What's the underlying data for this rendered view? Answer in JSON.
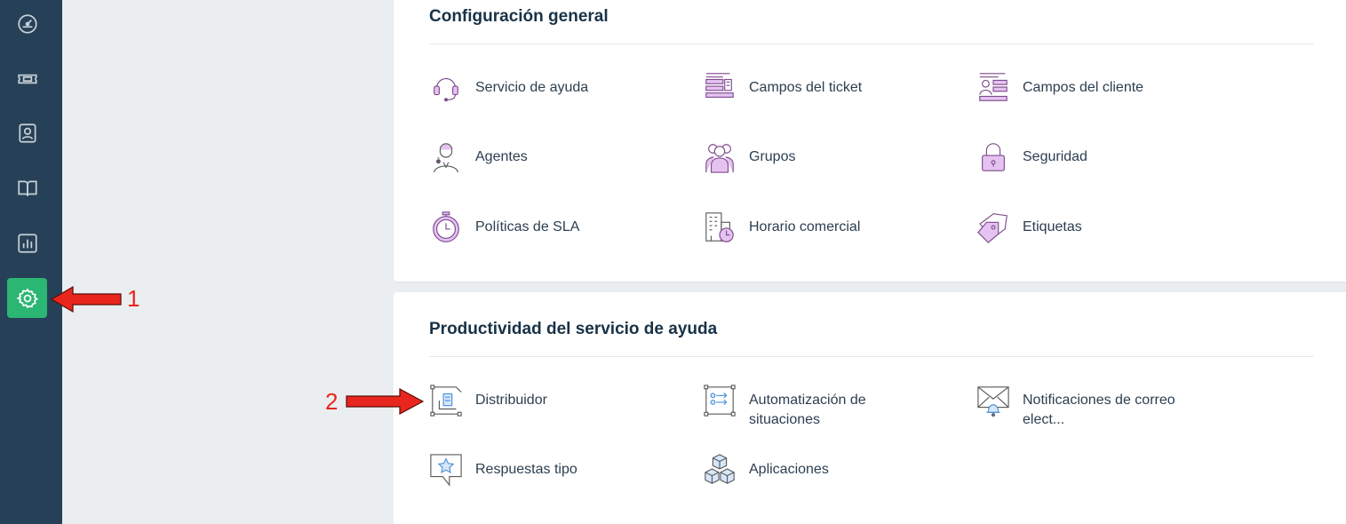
{
  "sidebar": {
    "items": [
      {
        "icon": "dashboard-icon"
      },
      {
        "icon": "ticket-icon"
      },
      {
        "icon": "contact-icon"
      },
      {
        "icon": "book-icon"
      },
      {
        "icon": "report-icon"
      },
      {
        "icon": "gear-icon",
        "active": true
      }
    ],
    "active_color": "#2bb673",
    "bg_color": "#264157"
  },
  "general": {
    "title": "Configuración general",
    "items": [
      {
        "label": "Servicio de ayuda",
        "icon": "headset-icon"
      },
      {
        "label": "Campos del ticket",
        "icon": "ticket-fields-icon"
      },
      {
        "label": "Campos del cliente",
        "icon": "customer-fields-icon"
      },
      {
        "label": "Agentes",
        "icon": "agent-icon"
      },
      {
        "label": "Grupos",
        "icon": "groups-icon"
      },
      {
        "label": "Seguridad",
        "icon": "lock-icon"
      },
      {
        "label": "Políticas de SLA",
        "icon": "stopwatch-icon"
      },
      {
        "label": "Horario comercial",
        "icon": "building-clock-icon"
      },
      {
        "label": "Etiquetas",
        "icon": "tags-icon"
      }
    ]
  },
  "productivity": {
    "title": "Productividad del servicio de ayuda",
    "items": [
      {
        "label": "Distribuidor",
        "icon": "dispatcher-icon"
      },
      {
        "label": "Automatización de situaciones",
        "icon": "automation-icon"
      },
      {
        "label": "Notificaciones de correo elect...",
        "icon": "email-bell-icon"
      },
      {
        "label": "Respuestas tipo",
        "icon": "canned-response-icon"
      },
      {
        "label": "Aplicaciones",
        "icon": "cubes-icon"
      }
    ]
  },
  "callouts": {
    "one": "1",
    "two": "2",
    "color": "#e8261d"
  }
}
